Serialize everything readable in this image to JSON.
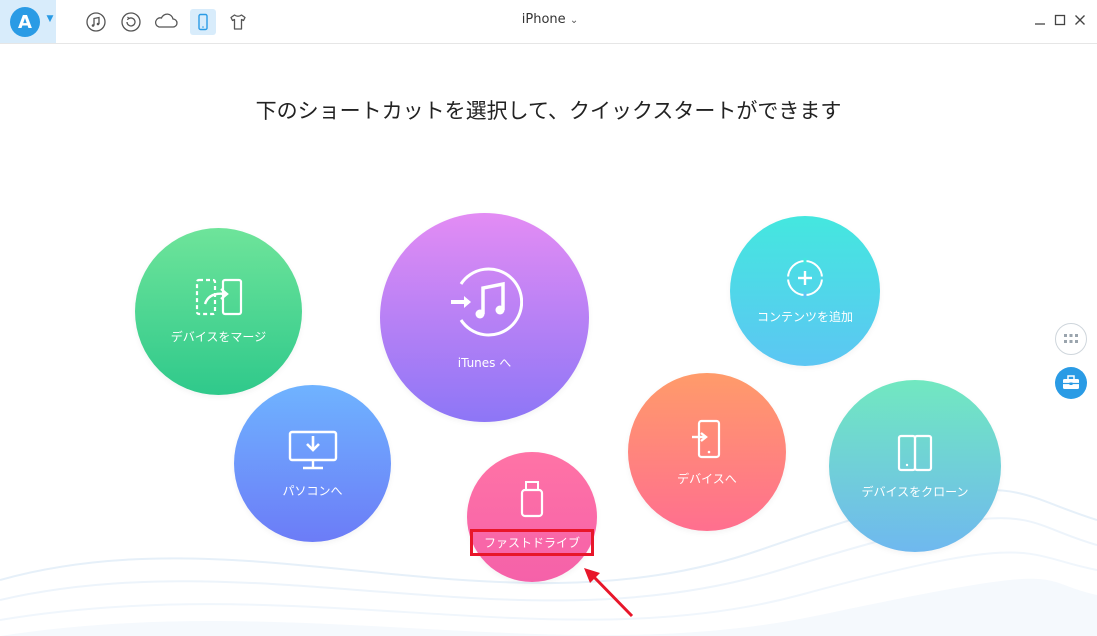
{
  "app": {
    "logo_letter": "A",
    "device_title": "iPhone",
    "toolbar_icons": [
      "music-icon",
      "history-icon",
      "cloud-icon",
      "phone-icon",
      "tshirt-icon"
    ],
    "active_toolbar_icon": "phone-icon"
  },
  "headline": "下のショートカットを選択して、クイックスタートができます",
  "shortcuts": {
    "merge": "デバイスをマージ",
    "pc": "パソコンへ",
    "itunes": "iTunes へ",
    "drive": "ファストドライブ",
    "add": "コンテンツを追加",
    "device": "デバイスへ",
    "clone": "デバイスをクローン"
  },
  "colors": {
    "accent": "#2a9be5",
    "highlight_box": "#e8162a",
    "arrow": "#e8162a"
  }
}
